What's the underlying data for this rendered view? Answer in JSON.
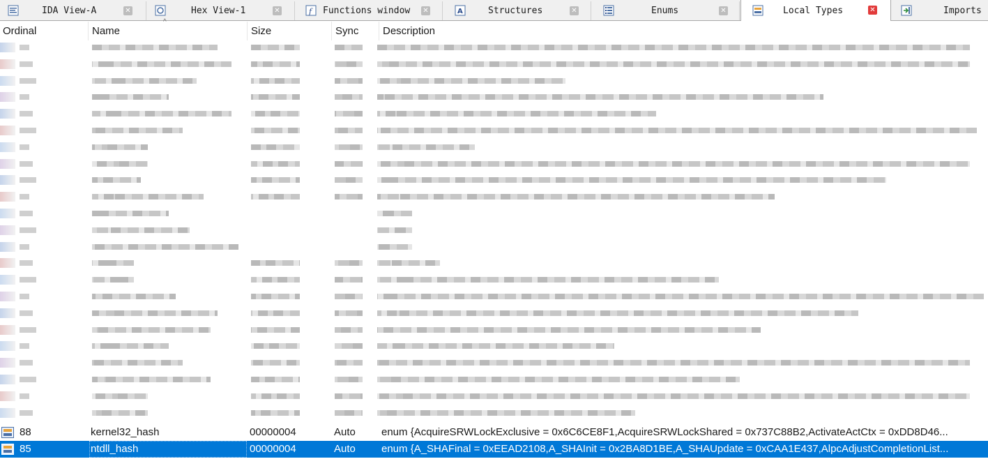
{
  "tabs": [
    {
      "label": "IDA View-A",
      "icon": "disassembly-view-icon",
      "active": false
    },
    {
      "label": "Hex View-1",
      "icon": "hex-view-icon",
      "active": false
    },
    {
      "label": "Functions window",
      "icon": "function-icon",
      "active": false
    },
    {
      "label": "Structures",
      "icon": "structures-icon",
      "active": false
    },
    {
      "label": "Enums",
      "icon": "enums-icon",
      "active": false
    },
    {
      "label": "Local Types",
      "icon": "local-types-icon",
      "active": true
    },
    {
      "label": "Imports",
      "icon": "imports-icon",
      "active": false
    }
  ],
  "columns": {
    "ordinal": "Ordinal",
    "name": "Name",
    "size": "Size",
    "sync": "Sync",
    "description": "Description"
  },
  "sort_indicator": "^",
  "rows": [
    {
      "ordinal": "88",
      "name": "kernel32_hash",
      "size": "00000004",
      "sync": "Auto",
      "description": "enum {AcquireSRWLockExclusive = 0x6C6CE8F1,AcquireSRWLockShared = 0x737C88B2,ActivateActCtx = 0xDD8D46...",
      "selected": false
    },
    {
      "ordinal": "85",
      "name": "ntdll_hash",
      "size": "00000004",
      "sync": "Auto",
      "description": "enum {A_SHAFinal = 0xEEAD2108,A_SHAInit = 0x2BA8D1BE,A_SHAUpdate = 0xCAA1E437,AlpcAdjustCompletionList...",
      "selected": true
    }
  ],
  "colors": {
    "selection": "#0078d7",
    "active_tab_close": "#e23b3b"
  }
}
